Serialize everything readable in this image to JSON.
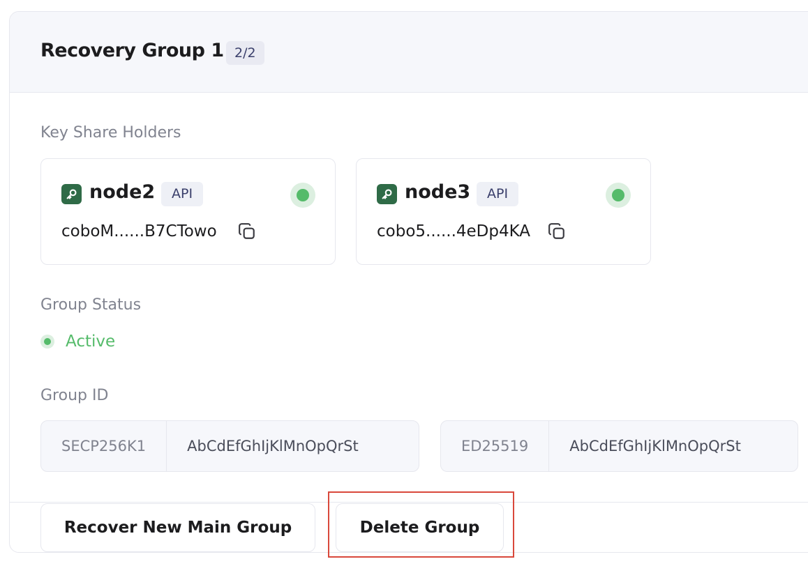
{
  "group": {
    "title": "Recovery Group 1",
    "count": "2/2"
  },
  "key_share_holders": {
    "label": "Key Share Holders",
    "holders": [
      {
        "name": "node2",
        "type": "API",
        "address": "coboM......B7CTowo"
      },
      {
        "name": "node3",
        "type": "API",
        "address": "cobo5......4eDp4KA"
      }
    ]
  },
  "group_status": {
    "label": "Group Status",
    "value": "Active"
  },
  "group_id": {
    "label": "Group ID",
    "entries": [
      {
        "algo": "SECP256K1",
        "value": "AbCdEfGhIjKlMnOpQrSt"
      },
      {
        "algo": "ED25519",
        "value": "AbCdEfGhIjKlMnOpQrSt"
      }
    ]
  },
  "actions": {
    "recover_label": "Recover New Main Group",
    "delete_label": "Delete Group"
  },
  "colors": {
    "active_green": "#55bb6a",
    "key_icon_green": "#2f6b47",
    "highlight_red": "#d9483b"
  }
}
